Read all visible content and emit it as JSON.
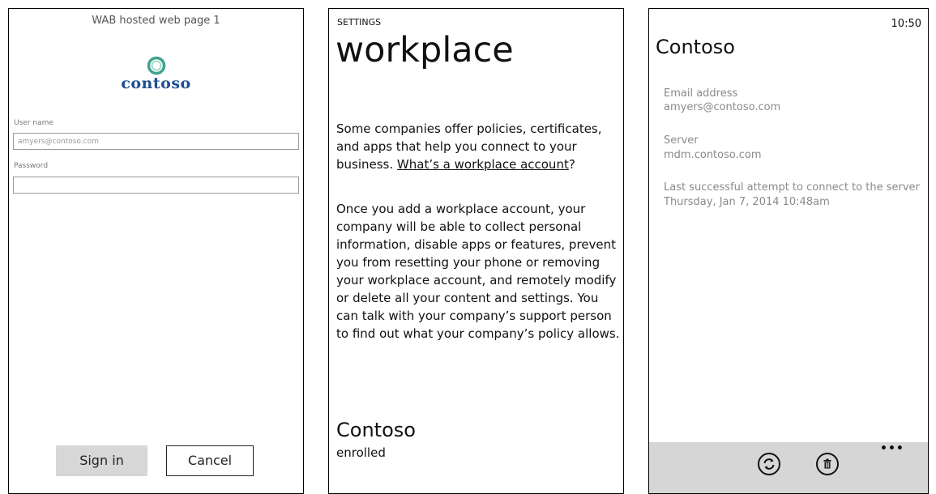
{
  "login": {
    "page_header": "WAB hosted web page 1",
    "logo_text": "contoso",
    "username_label": "User name",
    "username_value": "amyers@contoso.com",
    "password_label": "Password",
    "password_value": "",
    "signin_label": "Sign in",
    "cancel_label": "Cancel"
  },
  "settings": {
    "caption": "SETTINGS",
    "title": "workplace",
    "para1_text": "Some companies offer policies, certificates, and apps that help you connect to your business. ",
    "para1_link": "What’s a workplace account",
    "para1_end": "?",
    "para2": "Once you add a workplace account, your company will be able to collect personal information, disable apps or features, prevent you from resetting your phone or removing your workplace account, and remotely modify or delete all your content and settings. You can talk with your company’s support person to find out what your company’s policy allows.",
    "account_name": "Contoso",
    "account_status": "enrolled"
  },
  "account": {
    "clock": "10:50",
    "title": "Contoso",
    "email_label": "Email address",
    "email_value": "amyers@contoso.com",
    "server_label": "Server",
    "server_value": "mdm.contoso.com",
    "last_attempt_label": "Last successful attempt to connect to the server",
    "last_attempt_value": "Thursday, Jan 7, 2014 10:48am",
    "more_label": "•••",
    "icons": [
      "sync-icon",
      "delete-icon"
    ]
  },
  "colors": {
    "logo_blue": "#1d4f91",
    "logo_teal": "#3fa38f",
    "app_bar_bg": "#d6d6d6",
    "signin_bg": "#d7d7d7",
    "muted_text": "#8a8a8a"
  }
}
